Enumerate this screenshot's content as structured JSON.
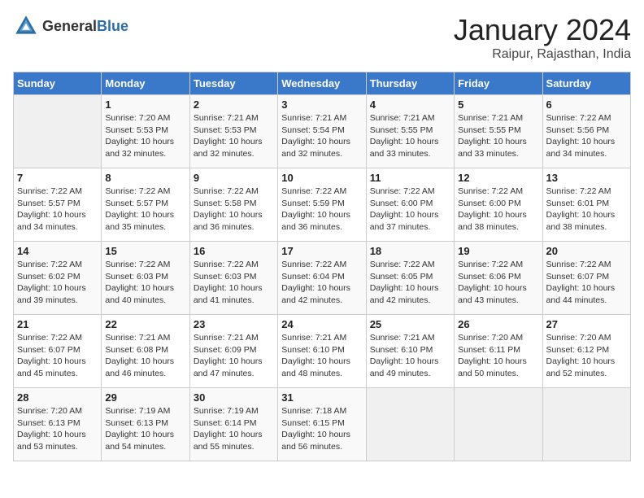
{
  "header": {
    "logo_general": "General",
    "logo_blue": "Blue",
    "month_year": "January 2024",
    "location": "Raipur, Rajasthan, India"
  },
  "weekdays": [
    "Sunday",
    "Monday",
    "Tuesday",
    "Wednesday",
    "Thursday",
    "Friday",
    "Saturday"
  ],
  "weeks": [
    [
      {
        "day": "",
        "info": ""
      },
      {
        "day": "1",
        "info": "Sunrise: 7:20 AM\nSunset: 5:53 PM\nDaylight: 10 hours\nand 32 minutes."
      },
      {
        "day": "2",
        "info": "Sunrise: 7:21 AM\nSunset: 5:53 PM\nDaylight: 10 hours\nand 32 minutes."
      },
      {
        "day": "3",
        "info": "Sunrise: 7:21 AM\nSunset: 5:54 PM\nDaylight: 10 hours\nand 32 minutes."
      },
      {
        "day": "4",
        "info": "Sunrise: 7:21 AM\nSunset: 5:55 PM\nDaylight: 10 hours\nand 33 minutes."
      },
      {
        "day": "5",
        "info": "Sunrise: 7:21 AM\nSunset: 5:55 PM\nDaylight: 10 hours\nand 33 minutes."
      },
      {
        "day": "6",
        "info": "Sunrise: 7:22 AM\nSunset: 5:56 PM\nDaylight: 10 hours\nand 34 minutes."
      }
    ],
    [
      {
        "day": "7",
        "info": "Sunrise: 7:22 AM\nSunset: 5:57 PM\nDaylight: 10 hours\nand 34 minutes."
      },
      {
        "day": "8",
        "info": "Sunrise: 7:22 AM\nSunset: 5:57 PM\nDaylight: 10 hours\nand 35 minutes."
      },
      {
        "day": "9",
        "info": "Sunrise: 7:22 AM\nSunset: 5:58 PM\nDaylight: 10 hours\nand 36 minutes."
      },
      {
        "day": "10",
        "info": "Sunrise: 7:22 AM\nSunset: 5:59 PM\nDaylight: 10 hours\nand 36 minutes."
      },
      {
        "day": "11",
        "info": "Sunrise: 7:22 AM\nSunset: 6:00 PM\nDaylight: 10 hours\nand 37 minutes."
      },
      {
        "day": "12",
        "info": "Sunrise: 7:22 AM\nSunset: 6:00 PM\nDaylight: 10 hours\nand 38 minutes."
      },
      {
        "day": "13",
        "info": "Sunrise: 7:22 AM\nSunset: 6:01 PM\nDaylight: 10 hours\nand 38 minutes."
      }
    ],
    [
      {
        "day": "14",
        "info": "Sunrise: 7:22 AM\nSunset: 6:02 PM\nDaylight: 10 hours\nand 39 minutes."
      },
      {
        "day": "15",
        "info": "Sunrise: 7:22 AM\nSunset: 6:03 PM\nDaylight: 10 hours\nand 40 minutes."
      },
      {
        "day": "16",
        "info": "Sunrise: 7:22 AM\nSunset: 6:03 PM\nDaylight: 10 hours\nand 41 minutes."
      },
      {
        "day": "17",
        "info": "Sunrise: 7:22 AM\nSunset: 6:04 PM\nDaylight: 10 hours\nand 42 minutes."
      },
      {
        "day": "18",
        "info": "Sunrise: 7:22 AM\nSunset: 6:05 PM\nDaylight: 10 hours\nand 42 minutes."
      },
      {
        "day": "19",
        "info": "Sunrise: 7:22 AM\nSunset: 6:06 PM\nDaylight: 10 hours\nand 43 minutes."
      },
      {
        "day": "20",
        "info": "Sunrise: 7:22 AM\nSunset: 6:07 PM\nDaylight: 10 hours\nand 44 minutes."
      }
    ],
    [
      {
        "day": "21",
        "info": "Sunrise: 7:22 AM\nSunset: 6:07 PM\nDaylight: 10 hours\nand 45 minutes."
      },
      {
        "day": "22",
        "info": "Sunrise: 7:21 AM\nSunset: 6:08 PM\nDaylight: 10 hours\nand 46 minutes."
      },
      {
        "day": "23",
        "info": "Sunrise: 7:21 AM\nSunset: 6:09 PM\nDaylight: 10 hours\nand 47 minutes."
      },
      {
        "day": "24",
        "info": "Sunrise: 7:21 AM\nSunset: 6:10 PM\nDaylight: 10 hours\nand 48 minutes."
      },
      {
        "day": "25",
        "info": "Sunrise: 7:21 AM\nSunset: 6:10 PM\nDaylight: 10 hours\nand 49 minutes."
      },
      {
        "day": "26",
        "info": "Sunrise: 7:20 AM\nSunset: 6:11 PM\nDaylight: 10 hours\nand 50 minutes."
      },
      {
        "day": "27",
        "info": "Sunrise: 7:20 AM\nSunset: 6:12 PM\nDaylight: 10 hours\nand 52 minutes."
      }
    ],
    [
      {
        "day": "28",
        "info": "Sunrise: 7:20 AM\nSunset: 6:13 PM\nDaylight: 10 hours\nand 53 minutes."
      },
      {
        "day": "29",
        "info": "Sunrise: 7:19 AM\nSunset: 6:13 PM\nDaylight: 10 hours\nand 54 minutes."
      },
      {
        "day": "30",
        "info": "Sunrise: 7:19 AM\nSunset: 6:14 PM\nDaylight: 10 hours\nand 55 minutes."
      },
      {
        "day": "31",
        "info": "Sunrise: 7:18 AM\nSunset: 6:15 PM\nDaylight: 10 hours\nand 56 minutes."
      },
      {
        "day": "",
        "info": ""
      },
      {
        "day": "",
        "info": ""
      },
      {
        "day": "",
        "info": ""
      }
    ]
  ]
}
